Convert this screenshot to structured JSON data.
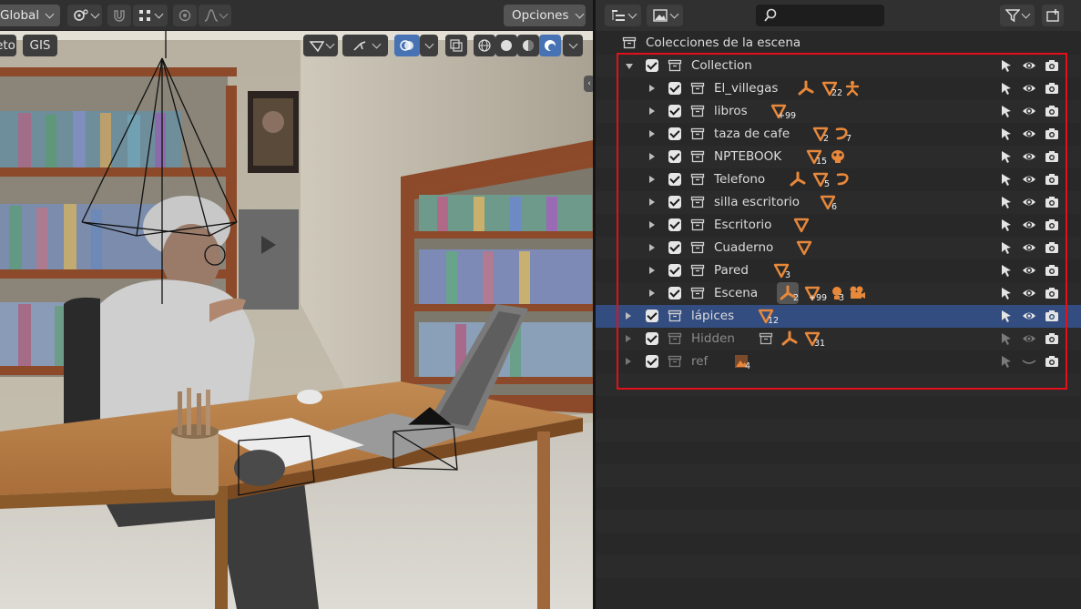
{
  "viewport_header": {
    "orientation": "Global",
    "options_label": "Opciones"
  },
  "viewport_overlay": {
    "left_btn_1": "eto",
    "left_btn_2": "GIS"
  },
  "outliner": {
    "scene_collection_label": "Colecciones de la escena",
    "rows": [
      {
        "name": "Collection",
        "expanded": true,
        "level": 0
      },
      {
        "name": "El_villegas",
        "counts": [
          "22"
        ]
      },
      {
        "name": "libros",
        "counts": [
          "99"
        ]
      },
      {
        "name": "taza de cafe",
        "counts": [
          "2",
          "7"
        ]
      },
      {
        "name": "NPTEBOOK",
        "counts": [
          "15"
        ]
      },
      {
        "name": "Telefono",
        "counts": [
          "5"
        ]
      },
      {
        "name": "silla escritorio",
        "counts": [
          "6"
        ]
      },
      {
        "name": "Escritorio",
        "counts": []
      },
      {
        "name": "Cuaderno",
        "counts": []
      },
      {
        "name": "Pared",
        "counts": [
          "3"
        ]
      },
      {
        "name": "Escena",
        "counts": [
          "2",
          "99",
          "3"
        ]
      },
      {
        "name": "lápices",
        "counts": [
          "12"
        ],
        "selected": true
      },
      {
        "name": "Hidden",
        "counts": [
          "31"
        ],
        "dim": true
      },
      {
        "name": "ref",
        "counts": [
          "4"
        ],
        "dim": true
      }
    ]
  },
  "colors": {
    "accent": "#4772b3",
    "selected_row": "#334d80",
    "object_icon": "#e8883a",
    "highlight_box": "#e3101a"
  },
  "icons": [
    "outliner-display-icon",
    "filter-icon",
    "search-icon",
    "new-collection-icon",
    "collection-icon",
    "checkbox-icon",
    "select-arrow-icon",
    "eye-icon",
    "camera-icon",
    "mesh-icon",
    "armature-icon",
    "bone-icon",
    "material-icon",
    "camera-object-icon",
    "image-icon"
  ]
}
